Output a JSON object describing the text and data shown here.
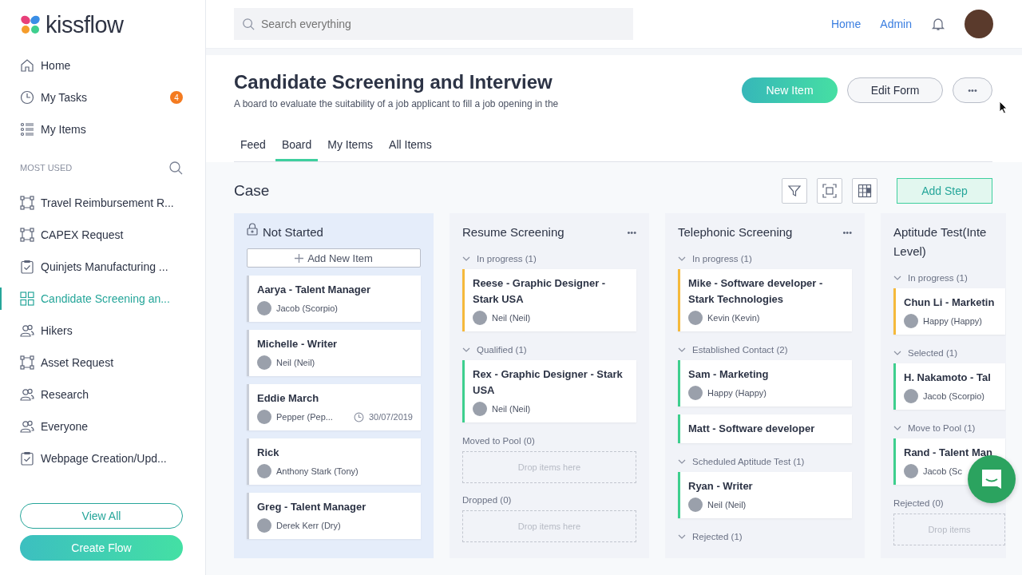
{
  "sidebar": {
    "logo": "kissflow",
    "nav": [
      {
        "label": "Home",
        "kind": "home"
      },
      {
        "label": "My Tasks",
        "kind": "clock",
        "badge": "4"
      },
      {
        "label": "My Items",
        "kind": "list"
      }
    ],
    "section_label": "MOST USED",
    "items": [
      {
        "label": "Travel Reimbursement R...",
        "kind": "flow",
        "selected": false
      },
      {
        "label": "CAPEX Request",
        "kind": "flow",
        "selected": false
      },
      {
        "label": "Quinjets Manufacturing ...",
        "kind": "check",
        "selected": false
      },
      {
        "label": "Candidate Screening an...",
        "kind": "grid",
        "selected": true
      },
      {
        "label": "Hikers",
        "kind": "people",
        "selected": false
      },
      {
        "label": "Asset Request",
        "kind": "flow",
        "selected": false
      },
      {
        "label": "Research",
        "kind": "people",
        "selected": false
      },
      {
        "label": "Everyone",
        "kind": "people",
        "selected": false
      },
      {
        "label": "Webpage Creation/Upd...",
        "kind": "check",
        "selected": false
      }
    ],
    "view_all": "View All",
    "create_flow": "Create Flow"
  },
  "topbar": {
    "search": {
      "placeholder": "Search everything"
    },
    "links": [
      "Home",
      "Admin"
    ]
  },
  "header": {
    "title": "Candidate Screening and Interview",
    "description": "A board to evaluate the suitability of a job applicant to fill a job opening in the",
    "new_item": "New Item",
    "edit_form": "Edit Form",
    "more": "•••",
    "tabs": [
      {
        "label": "Feed",
        "selected": false
      },
      {
        "label": "Board",
        "selected": true
      },
      {
        "label": "My Items",
        "selected": false
      },
      {
        "label": "All Items",
        "selected": false
      }
    ]
  },
  "board": {
    "title": "Case",
    "add_step": "Add Step",
    "columns": [
      {
        "title": "Not Started",
        "kind": "start",
        "add_item": "Add New Item",
        "groups": [
          {
            "cards": [
              {
                "title": "Aarya - Talent Manager",
                "person": "Jacob (Scorpio)",
                "color": "#c9ced8"
              },
              {
                "title": "Michelle - Writer",
                "person": "Neil (Neil)",
                "color": "#c9ced8"
              },
              {
                "title": "Eddie March",
                "person": "Pepper (Pep...",
                "date": "30/07/2019",
                "color": "#c9ced8"
              },
              {
                "title": "Rick",
                "person": "Anthony Stark (Tony)",
                "color": "#c9ced8"
              },
              {
                "title": "Greg - Talent Manager",
                "person": "Derek Kerr (Dry)",
                "color": "#c9ced8"
              }
            ]
          }
        ]
      },
      {
        "title": "Resume Screening",
        "kind": "step",
        "menu": "•••",
        "groups": [
          {
            "label": "In progress (1)",
            "collapsible": true,
            "cards": [
              {
                "title": "Reese - Graphic Designer - Stark USA",
                "person": "Neil (Neil)",
                "color": "#f5b93c"
              }
            ]
          },
          {
            "label": "Qualified (1)",
            "collapsible": true,
            "cards": [
              {
                "title": "Rex - Graphic Designer - Stark USA",
                "person": "Neil (Neil)",
                "color": "#3ecf8e"
              }
            ]
          },
          {
            "label": "Moved to Pool (0)",
            "collapsible": false,
            "empty": "Drop items here"
          },
          {
            "label": "Dropped (0)",
            "collapsible": false,
            "empty": "Drop items here"
          }
        ]
      },
      {
        "title": "Telephonic Screening",
        "kind": "step",
        "menu": "•••",
        "groups": [
          {
            "label": "In progress (1)",
            "collapsible": true,
            "cards": [
              {
                "title": "Mike - Software developer - Stark Technologies",
                "person": "Kevin (Kevin)",
                "color": "#f5b93c"
              }
            ]
          },
          {
            "label": "Established Contact (2)",
            "collapsible": true,
            "cards": [
              {
                "title": "Sam - Marketing",
                "person": "Happy (Happy)",
                "color": "#3ecf8e"
              },
              {
                "title": "Matt - Software developer",
                "color": "#3ecf8e"
              }
            ]
          },
          {
            "label": "Scheduled Aptitude Test (1)",
            "collapsible": true,
            "cards": [
              {
                "title": "Ryan - Writer",
                "person": "Neil (Neil)",
                "color": "#3ecf8e"
              }
            ]
          },
          {
            "label": "Rejected (1)",
            "collapsible": true
          }
        ]
      },
      {
        "title": "Aptitude Test(Inte Level)",
        "kind": "partial",
        "groups": [
          {
            "label": "In progress (1)",
            "collapsible": true,
            "cards": [
              {
                "title": "Chun Li - Marketin",
                "person": "Happy (Happy)",
                "color": "#f5b93c"
              }
            ]
          },
          {
            "label": "Selected (1)",
            "collapsible": true,
            "cards": [
              {
                "title": "H. Nakamoto - Tal",
                "person": "Jacob (Scorpio)",
                "color": "#3ecf8e"
              }
            ]
          },
          {
            "label": "Move to Pool (1)",
            "collapsible": true,
            "cards": [
              {
                "title": "Rand - Talent Man",
                "person": "Jacob (Sc",
                "color": "#3ecf8e"
              }
            ]
          },
          {
            "label": "Rejected (0)",
            "collapsible": false,
            "empty": "Drop items"
          }
        ]
      }
    ]
  }
}
